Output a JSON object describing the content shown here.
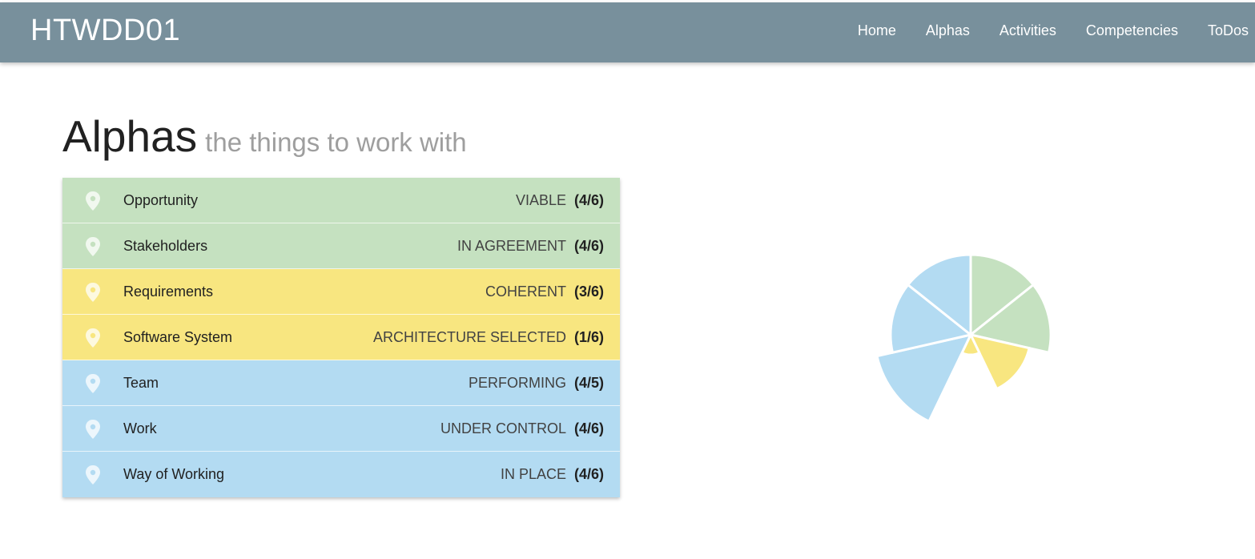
{
  "app": {
    "brand": "HTWDD01",
    "nav": [
      {
        "label": "Home"
      },
      {
        "label": "Alphas"
      },
      {
        "label": "Activities"
      },
      {
        "label": "Competencies"
      },
      {
        "label": "ToDos"
      }
    ]
  },
  "page": {
    "title": "Alphas",
    "subtitle": "the things to work with"
  },
  "colors": {
    "navbar": "#78909c",
    "customer": "#c5e1c0",
    "solution": "#f8e680",
    "endeavor": "#b3dbf2",
    "pin": "#ffffff"
  },
  "alphas": [
    {
      "name": "Opportunity",
      "state": "VIABLE",
      "progress": "(4/6)",
      "area": "customer",
      "icon": "location-pin-icon"
    },
    {
      "name": "Stakeholders",
      "state": "IN AGREEMENT",
      "progress": "(4/6)",
      "area": "customer",
      "icon": "location-pin-icon"
    },
    {
      "name": "Requirements",
      "state": "COHERENT",
      "progress": "(3/6)",
      "area": "solution",
      "icon": "location-pin-icon"
    },
    {
      "name": "Software System",
      "state": "ARCHITECTURE SELECTED",
      "progress": "(1/6)",
      "area": "solution",
      "icon": "location-pin-icon"
    },
    {
      "name": "Team",
      "state": "PERFORMING",
      "progress": "(4/5)",
      "area": "endeavor",
      "icon": "location-pin-icon"
    },
    {
      "name": "Work",
      "state": "UNDER CONTROL",
      "progress": "(4/6)",
      "area": "endeavor",
      "icon": "location-pin-icon"
    },
    {
      "name": "Way of Working",
      "state": "IN PLACE",
      "progress": "(4/6)",
      "area": "endeavor",
      "icon": "location-pin-icon"
    }
  ],
  "chart_data": {
    "type": "pie",
    "categories": [
      "Opportunity",
      "Stakeholders",
      "Requirements",
      "Software System",
      "Team",
      "Work",
      "Way of Working"
    ],
    "values": [
      0.667,
      0.667,
      0.5,
      0.167,
      0.8,
      0.667,
      0.667
    ],
    "colors": [
      "#c5e1c0",
      "#c5e1c0",
      "#f8e680",
      "#f8e680",
      "#b3dbf2",
      "#b3dbf2",
      "#b3dbf2"
    ]
  }
}
